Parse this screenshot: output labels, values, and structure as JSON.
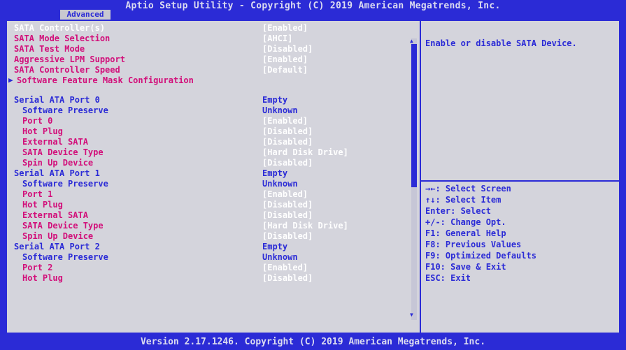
{
  "header": {
    "title": "Aptio Setup Utility - Copyright (C) 2019 American Megatrends, Inc.",
    "active_tab": "Advanced"
  },
  "menu": {
    "items": [
      {
        "label": "SATA Controller(s)",
        "value": "[Enabled]"
      },
      {
        "label": "SATA Mode Selection",
        "value": "[AHCI]"
      },
      {
        "label": "SATA Test Mode",
        "value": "[Disabled]"
      },
      {
        "label": "Aggressive LPM Support",
        "value": "[Enabled]"
      },
      {
        "label": "SATA Controller Speed",
        "value": "[Default]"
      },
      {
        "label": "Software Feature Mask Configuration",
        "value": ""
      },
      {
        "label": "Serial ATA Port 0",
        "value": "Empty"
      },
      {
        "label": "Software Preserve",
        "value": "Unknown"
      },
      {
        "label": "Port 0",
        "value": "[Enabled]"
      },
      {
        "label": "Hot Plug",
        "value": "[Disabled]"
      },
      {
        "label": "External SATA",
        "value": "[Disabled]"
      },
      {
        "label": "SATA Device Type",
        "value": "[Hard Disk Drive]"
      },
      {
        "label": "Spin Up Device",
        "value": "[Disabled]"
      },
      {
        "label": "Serial ATA Port 1",
        "value": "Empty"
      },
      {
        "label": "Software Preserve",
        "value": "Unknown"
      },
      {
        "label": "Port 1",
        "value": "[Enabled]"
      },
      {
        "label": "Hot Plug",
        "value": "[Disabled]"
      },
      {
        "label": "External SATA",
        "value": "[Disabled]"
      },
      {
        "label": "SATA Device Type",
        "value": "[Hard Disk Drive]"
      },
      {
        "label": "Spin Up Device",
        "value": "[Disabled]"
      },
      {
        "label": "Serial ATA Port 2",
        "value": "Empty"
      },
      {
        "label": "Software Preserve",
        "value": "Unknown"
      },
      {
        "label": "Port 2",
        "value": "[Enabled]"
      },
      {
        "label": "Hot Plug",
        "value": "[Disabled]"
      }
    ]
  },
  "help": {
    "text": "Enable or disable SATA Device."
  },
  "keys": [
    "→←: Select Screen",
    "↑↓: Select Item",
    "Enter: Select",
    "+/-: Change Opt.",
    "F1: General Help",
    "F8: Previous Values",
    "F9: Optimized Defaults",
    "F10: Save & Exit",
    "ESC: Exit"
  ],
  "footer": {
    "version": "Version 2.17.1246. Copyright (C) 2019 American Megatrends, Inc."
  },
  "colors": {
    "bios_blue": "#2b2bd6",
    "panel_gray": "#d4d4dc",
    "highlight_white": "#ffffff",
    "secondary_pink": "#d20f7a"
  }
}
